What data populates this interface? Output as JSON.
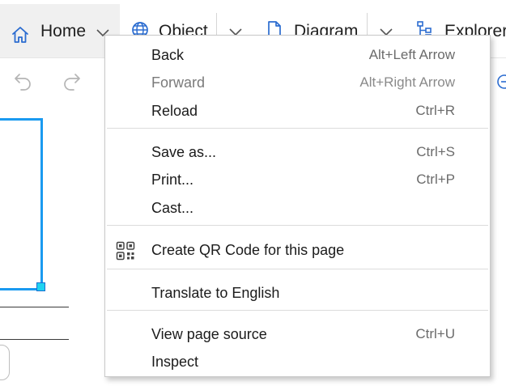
{
  "ribbon": {
    "tabs": [
      {
        "label": "Home",
        "icon": "home-icon"
      },
      {
        "label": "Object",
        "icon": "globe-icon"
      },
      {
        "label": "Diagram",
        "icon": "document-icon"
      },
      {
        "label": "Explorer",
        "icon": "tree-icon"
      }
    ],
    "quick_access": [
      "undo-icon",
      "redo-icon"
    ]
  },
  "colors": {
    "accent": "#2b6cd0",
    "selection": "#1a9af0",
    "handle": "#1fd3f0"
  },
  "context_menu": {
    "items": [
      {
        "label": "Back",
        "shortcut": "Alt+Left Arrow",
        "enabled": true
      },
      {
        "label": "Forward",
        "shortcut": "Alt+Right Arrow",
        "enabled": false
      },
      {
        "label": "Reload",
        "shortcut": "Ctrl+R",
        "enabled": true
      },
      {
        "label": "Save as...",
        "shortcut": "Ctrl+S",
        "enabled": true
      },
      {
        "label": "Print...",
        "shortcut": "Ctrl+P",
        "enabled": true
      },
      {
        "label": "Cast...",
        "shortcut": "",
        "enabled": true
      },
      {
        "label": "Create QR Code for this page",
        "shortcut": "",
        "icon": "qr-code-icon",
        "enabled": true
      },
      {
        "label": "Translate to English",
        "shortcut": "",
        "enabled": true
      },
      {
        "label": "View page source",
        "shortcut": "Ctrl+U",
        "enabled": true
      },
      {
        "label": "Inspect",
        "shortcut": "",
        "enabled": true
      }
    ]
  }
}
